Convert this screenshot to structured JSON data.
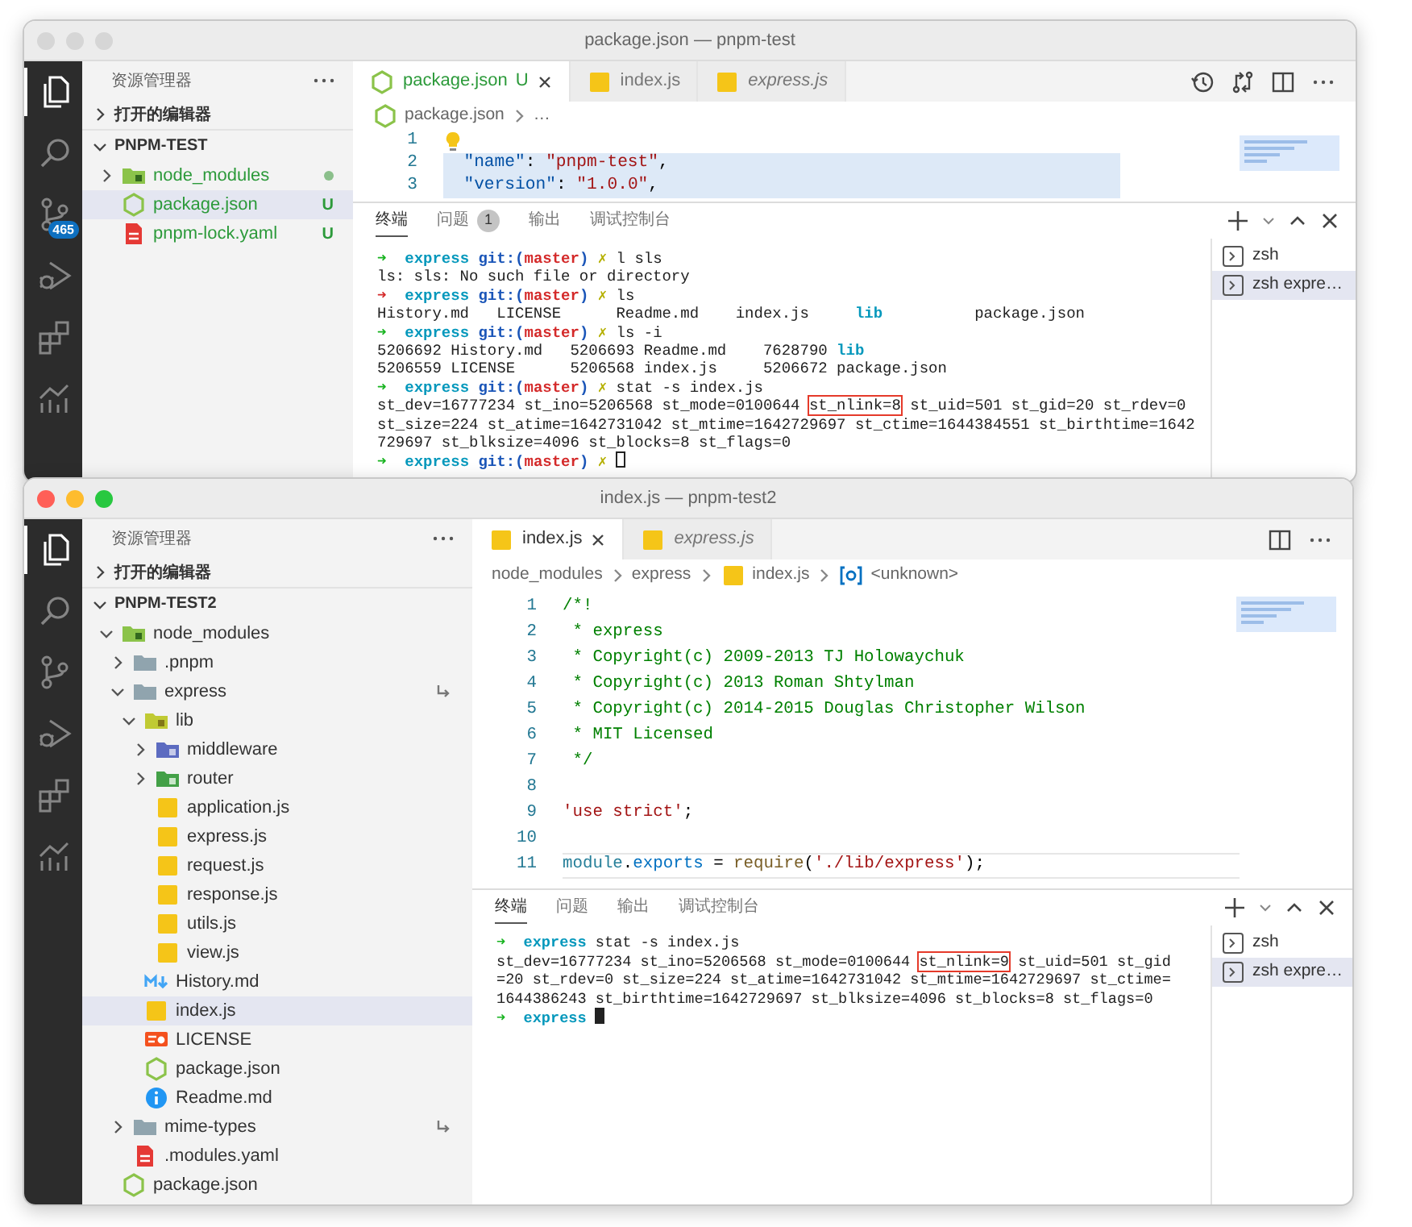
{
  "windows": [
    {
      "title": "package.json — pnpm-test",
      "focused": false,
      "activity": [
        {
          "kind": "files",
          "selected": true
        },
        {
          "kind": "search",
          "selected": false
        },
        {
          "kind": "scm",
          "selected": false,
          "badge": "465"
        },
        {
          "kind": "debug",
          "selected": false
        },
        {
          "kind": "extensions",
          "selected": false
        },
        {
          "kind": "chart",
          "selected": false
        }
      ],
      "sidebar": {
        "title": "资源管理器",
        "sections": [
          {
            "label": "打开的编辑器",
            "expanded": false
          },
          {
            "label": "PNPM-TEST",
            "expanded": true,
            "items": [
              {
                "label": "node_modules",
                "kind": "modules",
                "expanded": false,
                "selected": false,
                "untracked": true,
                "dot": true
              },
              {
                "label": "package.json",
                "kind": "manifest",
                "selected": true,
                "untracked": true,
                "status": "U"
              },
              {
                "label": "pnpm-lock.yaml",
                "kind": "lockfile",
                "selected": false,
                "untracked": true,
                "status": "U"
              }
            ]
          }
        ]
      },
      "tabs": [
        {
          "label": "package.json",
          "kind": "manifest",
          "selected": true,
          "preview": false,
          "untracked": true,
          "status": "U"
        },
        {
          "label": "index.js",
          "kind": "script",
          "selected": false,
          "preview": false,
          "untracked": false
        },
        {
          "label": "express.js",
          "kind": "script",
          "selected": false,
          "preview": true,
          "untracked": false
        }
      ],
      "editor_actions": [
        {
          "kind": "history"
        },
        {
          "kind": "compare"
        },
        {
          "kind": "split"
        },
        {
          "kind": "more"
        }
      ],
      "breadcrumb": [
        {
          "label": "package.json",
          "kind": "manifest"
        },
        {
          "label": "…",
          "kind": "text"
        }
      ],
      "code": [
        {
          "number": "1",
          "hint": true,
          "selected": false,
          "current": false
        },
        {
          "number": "2",
          "hint": false,
          "selected": true,
          "current": false,
          "segments": [
            {
              "kind": "key",
              "text": "  \"name\""
            },
            {
              "kind": "plain",
              "text": ": "
            },
            {
              "kind": "string",
              "text": "\"pnpm-test\""
            },
            {
              "kind": "plain",
              "text": ","
            }
          ]
        },
        {
          "number": "3",
          "hint": false,
          "selected": true,
          "current": false,
          "segments": [
            {
              "kind": "key",
              "text": "  \"version\""
            },
            {
              "kind": "plain",
              "text": ": "
            },
            {
              "kind": "string",
              "text": "\"1.0.0\""
            },
            {
              "kind": "plain",
              "text": ","
            }
          ]
        }
      ],
      "panel": {
        "tabs": [
          {
            "label": "终端",
            "selected": true
          },
          {
            "label": "问题",
            "selected": false,
            "count": "1"
          },
          {
            "label": "输出",
            "selected": false
          },
          {
            "label": "调试控制台",
            "selected": false
          }
        ],
        "terminal": [
          {
            "segments": [
              {
                "kind": "prompt",
                "text": "➜ ",
                "error": false
              },
              {
                "kind": "dir",
                "text": " express "
              },
              {
                "kind": "git",
                "text": "git:("
              },
              {
                "kind": "branch",
                "text": "master"
              },
              {
                "kind": "git",
                "text": ") "
              },
              {
                "kind": "dirty",
                "text": "✗ "
              },
              {
                "kind": "text",
                "text": "l sls"
              }
            ]
          },
          {
            "segments": [
              {
                "kind": "text",
                "text": "ls: sls: No such file or directory"
              }
            ]
          },
          {
            "segments": [
              {
                "kind": "prompt",
                "text": "➜ ",
                "error": true
              },
              {
                "kind": "dir",
                "text": " express "
              },
              {
                "kind": "git",
                "text": "git:("
              },
              {
                "kind": "branch",
                "text": "master"
              },
              {
                "kind": "git",
                "text": ") "
              },
              {
                "kind": "dirty",
                "text": "✗ "
              },
              {
                "kind": "text",
                "text": "ls"
              }
            ]
          },
          {
            "segments": [
              {
                "kind": "text",
                "text": "History.md   LICENSE      Readme.md    index.js     "
              },
              {
                "kind": "folder",
                "text": "lib"
              },
              {
                "kind": "text",
                "text": "          package.json"
              }
            ]
          },
          {
            "segments": [
              {
                "kind": "prompt",
                "text": "➜ ",
                "error": false
              },
              {
                "kind": "dir",
                "text": " express "
              },
              {
                "kind": "git",
                "text": "git:("
              },
              {
                "kind": "branch",
                "text": "master"
              },
              {
                "kind": "git",
                "text": ") "
              },
              {
                "kind": "dirty",
                "text": "✗ "
              },
              {
                "kind": "text",
                "text": "ls -i"
              }
            ]
          },
          {
            "segments": [
              {
                "kind": "text",
                "text": "5206692 History.md   5206693 Readme.md    7628790 "
              },
              {
                "kind": "folder",
                "text": "lib"
              }
            ]
          },
          {
            "segments": [
              {
                "kind": "text",
                "text": "5206559 LICENSE      5206568 index.js     5206672 package.json"
              }
            ]
          },
          {
            "segments": [
              {
                "kind": "prompt",
                "text": "➜ ",
                "error": false
              },
              {
                "kind": "dir",
                "text": " express "
              },
              {
                "kind": "git",
                "text": "git:("
              },
              {
                "kind": "branch",
                "text": "master"
              },
              {
                "kind": "git",
                "text": ") "
              },
              {
                "kind": "dirty",
                "text": "✗ "
              },
              {
                "kind": "text",
                "text": "stat -s index.js"
              }
            ]
          },
          {
            "segments": [
              {
                "kind": "text",
                "text": "st_dev=16777234 st_ino=5206568 st_mode=0100644 "
              },
              {
                "kind": "boxed",
                "text": "st_nlink=8"
              },
              {
                "kind": "text",
                "text": " st_uid=501 st_gid=20 st_rdev=0"
              }
            ]
          },
          {
            "segments": [
              {
                "kind": "text",
                "text": "st_size=224 st_atime=1642731042 st_mtime=1642729697 st_ctime=1644384551 st_birthtime=1642"
              }
            ]
          },
          {
            "segments": [
              {
                "kind": "text",
                "text": "729697 st_blksize=4096 st_blocks=8 st_flags=0"
              }
            ]
          },
          {
            "segments": [
              {
                "kind": "prompt",
                "text": "➜ ",
                "error": false
              },
              {
                "kind": "dir",
                "text": " express "
              },
              {
                "kind": "git",
                "text": "git:("
              },
              {
                "kind": "branch",
                "text": "master"
              },
              {
                "kind": "git",
                "text": ") "
              },
              {
                "kind": "dirty",
                "text": "✗ "
              },
              {
                "kind": "cursor"
              }
            ]
          }
        ],
        "sessions": [
          {
            "label": "zsh",
            "selected": false
          },
          {
            "label": "zsh expre…",
            "selected": true
          }
        ]
      }
    },
    {
      "title": "index.js — pnpm-test2",
      "focused": true,
      "activity": [
        {
          "kind": "files",
          "selected": true
        },
        {
          "kind": "search",
          "selected": false
        },
        {
          "kind": "scm",
          "selected": false
        },
        {
          "kind": "debug",
          "selected": false
        },
        {
          "kind": "extensions",
          "selected": false
        },
        {
          "kind": "chart",
          "selected": false
        }
      ],
      "sidebar": {
        "title": "资源管理器",
        "sections": [
          {
            "label": "打开的编辑器",
            "expanded": false
          },
          {
            "label": "PNPM-TEST2",
            "expanded": true,
            "items": [
              {
                "label": "node_modules",
                "kind": "modules",
                "expanded": true,
                "selected": false,
                "children": [
                  {
                    "label": ".pnpm",
                    "kind": "folder",
                    "expanded": false,
                    "selected": false
                  },
                  {
                    "label": "express",
                    "kind": "folder",
                    "expanded": true,
                    "selected": false,
                    "link": true,
                    "children": [
                      {
                        "label": "lib",
                        "kind": "libfolder",
                        "expanded": true,
                        "selected": false,
                        "children": [
                          {
                            "label": "middleware",
                            "kind": "mwfolder",
                            "expanded": false,
                            "selected": false
                          },
                          {
                            "label": "router",
                            "kind": "routerfolder",
                            "expanded": false,
                            "selected": false
                          },
                          {
                            "label": "application.js",
                            "kind": "script",
                            "selected": false
                          },
                          {
                            "label": "express.js",
                            "kind": "script",
                            "selected": false
                          },
                          {
                            "label": "request.js",
                            "kind": "script",
                            "selected": false
                          },
                          {
                            "label": "response.js",
                            "kind": "script",
                            "selected": false
                          },
                          {
                            "label": "utils.js",
                            "kind": "script",
                            "selected": false
                          },
                          {
                            "label": "view.js",
                            "kind": "script",
                            "selected": false
                          }
                        ]
                      },
                      {
                        "label": "History.md",
                        "kind": "markdown",
                        "selected": false
                      },
                      {
                        "label": "index.js",
                        "kind": "script",
                        "selected": true
                      },
                      {
                        "label": "LICENSE",
                        "kind": "license",
                        "selected": false
                      },
                      {
                        "label": "package.json",
                        "kind": "manifest",
                        "selected": false
                      },
                      {
                        "label": "Readme.md",
                        "kind": "readme",
                        "selected": false
                      }
                    ]
                  },
                  {
                    "label": "mime-types",
                    "kind": "folder",
                    "expanded": false,
                    "selected": false,
                    "link": true
                  },
                  {
                    "label": ".modules.yaml",
                    "kind": "lockfile",
                    "selected": false
                  }
                ]
              },
              {
                "label": "package.json",
                "kind": "manifest",
                "selected": false
              }
            ]
          }
        ]
      },
      "tabs": [
        {
          "label": "index.js",
          "kind": "script",
          "selected": true,
          "preview": false,
          "untracked": false
        },
        {
          "label": "express.js",
          "kind": "script",
          "selected": false,
          "preview": true,
          "untracked": false
        }
      ],
      "editor_actions": [
        {
          "kind": "split"
        },
        {
          "kind": "more"
        }
      ],
      "breadcrumb": [
        {
          "label": "node_modules",
          "kind": "text"
        },
        {
          "label": "express",
          "kind": "text"
        },
        {
          "label": "index.js",
          "kind": "script"
        },
        {
          "label": "<unknown>",
          "kind": "symbol"
        }
      ],
      "code": [
        {
          "number": "1",
          "hint": false,
          "selected": false,
          "current": false,
          "segments": [
            {
              "kind": "comment",
              "text": "/*!"
            }
          ]
        },
        {
          "number": "2",
          "hint": false,
          "selected": false,
          "current": false,
          "segments": [
            {
              "kind": "comment",
              "text": " * express"
            }
          ]
        },
        {
          "number": "3",
          "hint": false,
          "selected": false,
          "current": false,
          "segments": [
            {
              "kind": "comment",
              "text": " * Copyright(c) 2009-2013 TJ Holowaychuk"
            }
          ]
        },
        {
          "number": "4",
          "hint": false,
          "selected": false,
          "current": false,
          "segments": [
            {
              "kind": "comment",
              "text": " * Copyright(c) 2013 Roman Shtylman"
            }
          ]
        },
        {
          "number": "5",
          "hint": false,
          "selected": false,
          "current": false,
          "segments": [
            {
              "kind": "comment",
              "text": " * Copyright(c) 2014-2015 Douglas Christopher Wilson"
            }
          ]
        },
        {
          "number": "6",
          "hint": false,
          "selected": false,
          "current": false,
          "segments": [
            {
              "kind": "comment",
              "text": " * MIT Licensed"
            }
          ]
        },
        {
          "number": "7",
          "hint": false,
          "selected": false,
          "current": false,
          "segments": [
            {
              "kind": "comment",
              "text": " */"
            }
          ]
        },
        {
          "number": "8",
          "hint": false,
          "selected": false,
          "current": false
        },
        {
          "number": "9",
          "hint": false,
          "selected": false,
          "current": false,
          "segments": [
            {
              "kind": "string",
              "text": "'use strict'"
            },
            {
              "kind": "plain",
              "text": ";"
            }
          ]
        },
        {
          "number": "10",
          "hint": false,
          "selected": false,
          "current": false
        },
        {
          "number": "11",
          "hint": false,
          "selected": false,
          "current": true,
          "segments": [
            {
              "kind": "variable",
              "text": "module"
            },
            {
              "kind": "plain",
              "text": "."
            },
            {
              "kind": "property",
              "text": "exports"
            },
            {
              "kind": "plain",
              "text": " = "
            },
            {
              "kind": "function",
              "text": "require"
            },
            {
              "kind": "plain",
              "text": "("
            },
            {
              "kind": "string",
              "text": "'./lib/express'"
            },
            {
              "kind": "plain",
              "text": ");"
            }
          ]
        }
      ],
      "panel": {
        "tabs": [
          {
            "label": "终端",
            "selected": true
          },
          {
            "label": "问题",
            "selected": false
          },
          {
            "label": "输出",
            "selected": false
          },
          {
            "label": "调试控制台",
            "selected": false
          }
        ],
        "terminal": [
          {
            "segments": [
              {
                "kind": "prompt",
                "text": "➜ ",
                "error": false
              },
              {
                "kind": "dir",
                "text": " express "
              },
              {
                "kind": "text",
                "text": "stat -s index.js"
              }
            ]
          },
          {
            "segments": [
              {
                "kind": "text",
                "text": "st_dev=16777234 st_ino=5206568 st_mode=0100644 "
              },
              {
                "kind": "boxed",
                "text": "st_nlink=9"
              },
              {
                "kind": "text",
                "text": " st_uid=501 st_gid"
              }
            ]
          },
          {
            "segments": [
              {
                "kind": "text",
                "text": "=20 st_rdev=0 st_size=224 st_atime=1642731042 st_mtime=1642729697 st_ctime="
              }
            ]
          },
          {
            "segments": [
              {
                "kind": "text",
                "text": "1644386243 st_birthtime=1642729697 st_blksize=4096 st_blocks=8 st_flags=0"
              }
            ]
          },
          {
            "segments": [
              {
                "kind": "prompt",
                "text": "➜ ",
                "error": false
              },
              {
                "kind": "dir",
                "text": " express "
              },
              {
                "kind": "cursor"
              }
            ]
          }
        ],
        "sessions": [
          {
            "label": "zsh",
            "selected": false
          },
          {
            "label": "zsh expre…",
            "selected": true
          }
        ]
      }
    }
  ]
}
